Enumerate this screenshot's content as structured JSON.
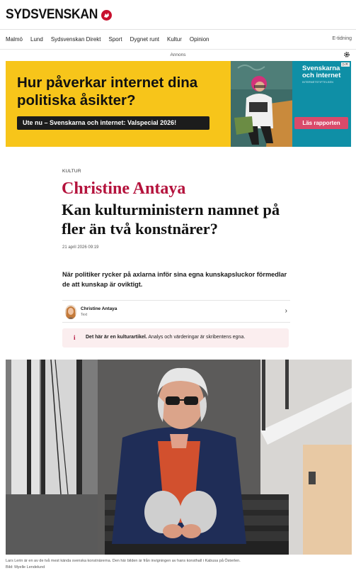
{
  "site": {
    "logo_text": "SYDSVENSKAN",
    "nav_items": [
      "Malmö",
      "Lund",
      "Sydsvenskan Direkt",
      "Sport",
      "Dygnet runt",
      "Kultur",
      "Opinion"
    ],
    "edition_label": "E-tidning"
  },
  "ad": {
    "label": "Annons",
    "headline": "Hur påverkar internet dina politiska åsikter?",
    "pill": "Ute nu – Svenskarna och internet: Valspecial 2026!",
    "brand": "Svenskarna och internet",
    "brand_sub": "INTERNETSTIFTELSEN",
    "cta": "Läs rapporten",
    "badge": "▷✕"
  },
  "article": {
    "kicker": "KULTUR",
    "author_title": "Christine Antaya",
    "headline": "Kan kulturministern namnet på fler än två konstnärer?",
    "date": "21 april 2026 09:19",
    "ingress": "När politiker rycker på axlarna inför sina egna kunskapsluckor förmedlar de att kunskap är oviktigt.",
    "byline": {
      "name": "Christine Antaya",
      "role": "Text"
    },
    "notice": {
      "strong": "Det här är en kulturartikel.",
      "text": " Analys och värderingar är skribentens egna."
    },
    "caption": "Lars Lerin är en av de två mest kända svenska konstnärerna. Den här bilden är från invigningen av hans konsthall i Kabusa på Österlen.",
    "credit": "Bild: Myelle Lendelund"
  },
  "colors": {
    "accent": "#b4123c",
    "ad_yellow": "#f7c51a",
    "ad_teal": "#0f8fa6"
  }
}
